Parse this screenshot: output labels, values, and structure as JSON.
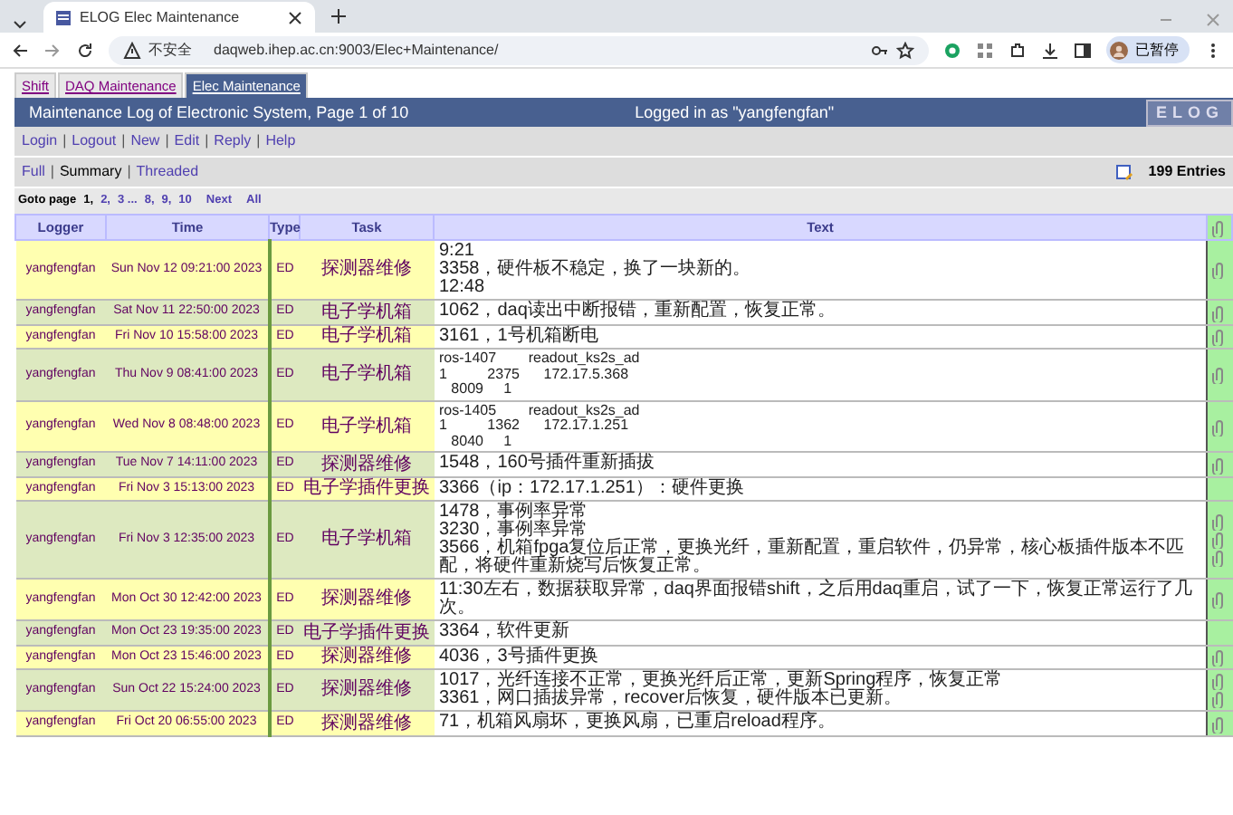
{
  "browser": {
    "tab_title": "ELOG Elec Maintenance",
    "security": "不安全",
    "url": "daqweb.ihep.ac.cn:9003/Elec+Maintenance/",
    "profile": "已暂停"
  },
  "logbook_tabs": [
    {
      "label": "Shift",
      "selected": false
    },
    {
      "label": "DAQ Maintenance",
      "selected": false
    },
    {
      "label": "Elec Maintenance",
      "selected": true
    }
  ],
  "title": "Maintenance Log of Electronic System, Page 1 of 10",
  "login_status": "Logged in as \"yangfengfan\"",
  "logo": "ELOG",
  "menu": {
    "separator": "|",
    "items": [
      "Login",
      "Logout",
      "New",
      "Edit",
      "Reply",
      "Help"
    ]
  },
  "views": {
    "separator": "|",
    "items": [
      {
        "label": "Full",
        "selected": false
      },
      {
        "label": "Summary",
        "selected": true
      },
      {
        "label": "Threaded",
        "selected": false
      }
    ]
  },
  "entries_count": "199 Entries",
  "goto": {
    "label": "Goto page",
    "pages": [
      {
        "label": "1,",
        "selected": true
      },
      {
        "label": "2,",
        "selected": false
      },
      {
        "label": "3 ...",
        "selected": false
      },
      {
        "label": "8,",
        "selected": false
      },
      {
        "label": "9,",
        "selected": false
      },
      {
        "label": "10",
        "selected": false
      }
    ],
    "links": [
      "Next",
      "All"
    ]
  },
  "columns": [
    "Logger",
    "Time",
    "Type",
    "Task",
    "Text"
  ],
  "rows": [
    {
      "logger": "yangfengfan",
      "time": "Sun Nov 12 09:21:00 2023",
      "type": "ED",
      "task": "探测器维修",
      "text": [
        "9:21",
        "3358，硬件板不稳定，换了一块新的。",
        "12:48"
      ],
      "attachments": [
        {
          "kind": "file"
        }
      ]
    },
    {
      "logger": "yangfengfan",
      "time": "Sat Nov 11 22:50:00 2023",
      "type": "ED",
      "task": "电子学机箱",
      "text": [
        "1062，daq读出中断报错，重新配置，恢复正常。"
      ],
      "attachments": [
        {
          "kind": "file"
        }
      ]
    },
    {
      "logger": "yangfengfan",
      "time": "Fri Nov 10 15:58:00 2023",
      "type": "ED",
      "task": "电子学机箱",
      "text": [
        "3161，1号机箱断电"
      ],
      "attachments": [
        {
          "kind": "file"
        }
      ]
    },
    {
      "logger": "yangfengfan",
      "time": "Thu Nov 9 08:41:00 2023",
      "type": "ED",
      "task": "电子学机箱",
      "text": [
        "ros-1407        readout_ks2s_ad",
        "1          2375      172.17.5.368",
        "   8009     1"
      ],
      "attachments": [
        {
          "kind": "file"
        }
      ]
    },
    {
      "logger": "yangfengfan",
      "time": "Wed Nov 8 08:48:00 2023",
      "type": "ED",
      "task": "电子学机箱",
      "text": [
        "ros-1405        readout_ks2s_ad",
        "1          1362      172.17.1.251",
        "   8040     1"
      ],
      "attachments": [
        {
          "kind": "file"
        }
      ]
    },
    {
      "logger": "yangfengfan",
      "time": "Tue Nov 7 14:11:00 2023",
      "type": "ED",
      "task": "探测器维修",
      "text": [
        "1548，160号插件重新插拔"
      ],
      "attachments": [
        {
          "kind": "file"
        }
      ]
    },
    {
      "logger": "yangfengfan",
      "time": "Fri Nov 3 15:13:00 2023",
      "type": "ED",
      "task": "电子学插件更换",
      "text": [
        "3366（ip：172.17.1.251）：硬件更换"
      ]
    },
    {
      "logger": "yangfengfan",
      "time": "Fri Nov 3 12:35:00 2023",
      "type": "ED",
      "task": "电子学机箱",
      "text": [
        "1478，事例率异常",
        "3230，事例率异常",
        "3566，机箱fpga复位后正常，更换光纤，重新配置，重启软件，仍异常，核心板插件版本不匹配，将硬件重新烧写后恢复正常。"
      ],
      "attachments": [
        {
          "kind": "file"
        },
        {
          "kind": "file"
        },
        {
          "kind": "file"
        }
      ]
    },
    {
      "logger": "yangfengfan",
      "time": "Mon Oct 30 12:42:00 2023",
      "type": "ED",
      "task": "探测器维修",
      "text": [
        "11:30左右，数据获取异常，daq界面报错shift，之后用daq重启，试了一下，恢复正常运行了几次。"
      ],
      "attachments": [
        {
          "kind": "file"
        }
      ]
    },
    {
      "logger": "yangfengfan",
      "time": "Mon Oct 23 19:35:00 2023",
      "type": "ED",
      "task": "电子学插件更换",
      "text": [
        "3364，软件更新"
      ]
    },
    {
      "logger": "yangfengfan",
      "time": "Mon Oct 23 15:46:00 2023",
      "type": "ED",
      "task": "探测器维修",
      "text": [
        "4036，3号插件更换"
      ],
      "attachments": [
        {
          "kind": "file"
        }
      ]
    },
    {
      "logger": "yangfengfan",
      "time": "Sun Oct 22 15:24:00 2023",
      "type": "ED",
      "task": "探测器维修",
      "text": [
        "1017，光纤连接不正常，更换光纤后正常，更新Spring程序，恢复正常",
        "3361，网口插拔异常，recover后恢复，硬件版本已更新。"
      ],
      "attachments": [
        {
          "kind": "file"
        },
        {
          "kind": "file"
        }
      ]
    },
    {
      "logger": "yangfengfan",
      "time": "Fri Oct 20 06:55:00 2023",
      "type": "ED",
      "task": "探测器维修",
      "text": [
        "71，机箱风扇坏，更换风扇，已重启reload程序。"
      ],
      "attachments": [
        {
          "kind": "file"
        }
      ]
    }
  ]
}
